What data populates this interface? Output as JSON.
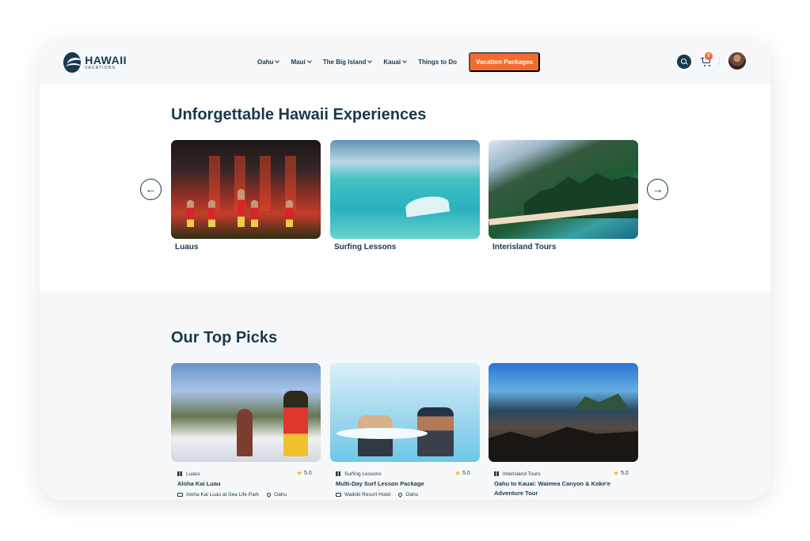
{
  "brand": {
    "logo_main": "HAWAII",
    "logo_sub": "VACATIONS"
  },
  "nav": {
    "items": [
      {
        "label": "Oahu",
        "has_dropdown": true
      },
      {
        "label": "Maui",
        "has_dropdown": true
      },
      {
        "label": "The Big Island",
        "has_dropdown": true
      },
      {
        "label": "Kauai",
        "has_dropdown": true
      },
      {
        "label": "Things to Do",
        "has_dropdown": false
      }
    ],
    "cta": "Vacation Packages",
    "cart_count": "0"
  },
  "experiences": {
    "title": "Unforgettable Hawaii Experiences",
    "items": [
      {
        "label": "Luaus"
      },
      {
        "label": "Surfing Lessons"
      },
      {
        "label": "Interisland Tours"
      }
    ]
  },
  "top_picks": {
    "title": "Our Top Picks",
    "items": [
      {
        "category": "Luaus",
        "rating": "5.0",
        "title": "Aloha Kai Luau",
        "venue": "Aloha Kai Luau at Sea Life Park",
        "location": "Oahu"
      },
      {
        "category": "Surfing Lessons",
        "rating": "5.0",
        "title": "Multi-Day Surf Lesson Package",
        "venue": "Waikiki Resort Hotel",
        "location": "Oahu"
      },
      {
        "category": "Interisland Tours",
        "rating": "5.0",
        "title": "Oahu to Kauai: Waimea Canyon & Koke'e Adventure Tour"
      }
    ]
  },
  "colors": {
    "brand": "#17394d",
    "accent": "#f26b2f",
    "background": "#f7f8fa"
  }
}
